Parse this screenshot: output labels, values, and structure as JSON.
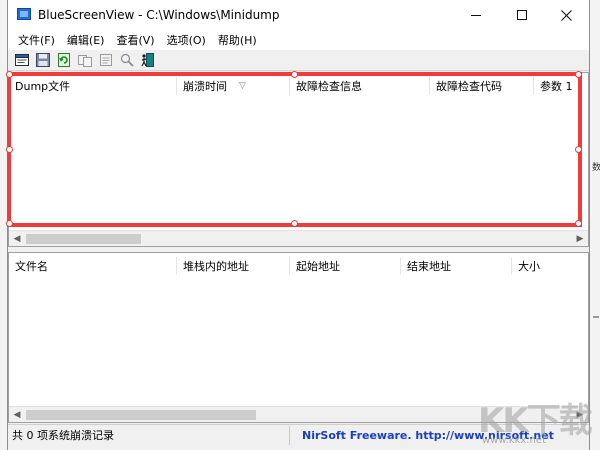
{
  "window": {
    "title": "BlueScreenView  -  C:\\Windows\\Minidump",
    "icons": {
      "app": "app-bsod-icon",
      "minimize": "minimize-icon",
      "maximize": "maximize-icon",
      "close": "close-icon"
    }
  },
  "menu": {
    "items": [
      {
        "label": "文件(F)"
      },
      {
        "label": "编辑(E)"
      },
      {
        "label": "查看(V)"
      },
      {
        "label": "选项(O)"
      },
      {
        "label": "帮助(H)"
      }
    ]
  },
  "toolbar": {
    "buttons": [
      {
        "icon": "html-report-icon"
      },
      {
        "icon": "save-icon"
      },
      {
        "icon": "refresh-icon"
      },
      {
        "icon": "copy-icon"
      },
      {
        "icon": "properties-icon"
      },
      {
        "icon": "find-icon"
      },
      {
        "icon": "exit-icon"
      }
    ]
  },
  "top_list": {
    "columns": [
      {
        "label": "Dump文件"
      },
      {
        "label": "崩溃时间",
        "sort_icon": "▽"
      },
      {
        "label": "故障检查信息"
      },
      {
        "label": "故障检查代码"
      },
      {
        "label": "参数 1"
      }
    ]
  },
  "bottom_list": {
    "columns": [
      {
        "label": "文件名"
      },
      {
        "label": "堆栈内的地址"
      },
      {
        "label": "起始地址"
      },
      {
        "label": "结束地址"
      },
      {
        "label": "大小"
      }
    ]
  },
  "status": {
    "count_text": "共 0 项系统崩溃记录",
    "credit_text": "NirSoft Freeware.  http://www.nirsoft.net"
  },
  "watermark": {
    "logo": "KK下载",
    "url": "www.kkx.net"
  },
  "background": {
    "right_edge_char": "数"
  },
  "colors": {
    "selection": "#ef3b3b",
    "credit_link": "#1a3fbf",
    "window_bg": "#f0f0f0"
  }
}
